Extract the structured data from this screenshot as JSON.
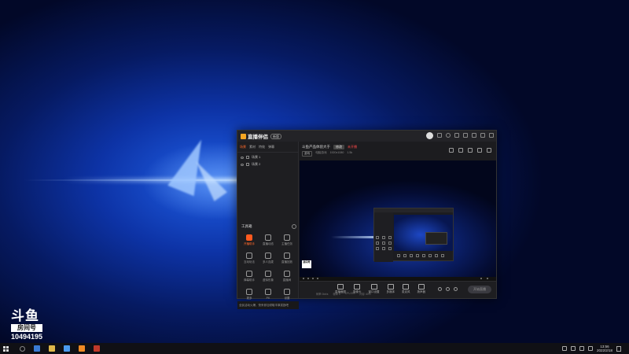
{
  "watermark": {
    "logo": "斗鱼",
    "label": "房间号",
    "room_number": "10494195"
  },
  "app": {
    "name": "直播伴侣",
    "version_badge": "新版",
    "sidebar": {
      "tabs": [
        "场景",
        "素材",
        "特效",
        "弹幕"
      ],
      "scenes": [
        {
          "label": "场景 1"
        },
        {
          "label": "场景 2"
        }
      ],
      "toolbox_title": "工具箱",
      "tools": [
        {
          "label": "开播助手",
          "hot": true
        },
        {
          "label": "直播动态",
          "hot": false
        },
        {
          "label": "主播任务",
          "hot": false
        },
        {
          "label": "互动玩法",
          "hot": false
        },
        {
          "label": "多人连麦",
          "hot": false
        },
        {
          "label": "直播回放",
          "hot": false
        },
        {
          "label": "弹幕助手",
          "hot": false
        },
        {
          "label": "虚拟形象",
          "hot": false
        },
        {
          "label": "直播间",
          "hot": false
        },
        {
          "label": "更多",
          "hot": false
        },
        {
          "label": "PK",
          "hot": false
        },
        {
          "label": "设置",
          "hot": false
        }
      ],
      "notice": "全民活动火爆，快来参加领取丰厚奖励吧"
    },
    "main": {
      "room_title": "斗鱼产品体验大于",
      "room_edit": "修改",
      "room_status": "未开播",
      "meta": {
        "category": "游戏",
        "tag1": "电脑游戏",
        "tag2": "1920x1080",
        "viewers": "1.5k"
      },
      "preview_badge": "房间号",
      "actions": [
        {
          "label": "直播截图",
          "icon": "screenshot-icon"
        },
        {
          "label": "摄像头",
          "icon": "camera-icon"
        },
        {
          "label": "窗口设置",
          "icon": "window-icon"
        },
        {
          "label": "多媒体",
          "icon": "media-icon"
        },
        {
          "label": "麦克风",
          "icon": "mic-icon"
        },
        {
          "label": "扬声器",
          "icon": "speaker-icon"
        }
      ],
      "start_button": "开始直播",
      "status_items": [
        "码率 0kb/s",
        "帧率 0",
        "CPU 8%",
        "内存 40%"
      ]
    }
  },
  "taskbar": {
    "time": "13:56",
    "date": "2022/2/18"
  },
  "colors": {
    "accent": "#ff6a2c",
    "wallpaper": "#0d33a6",
    "panel": "#1c1c1f"
  }
}
